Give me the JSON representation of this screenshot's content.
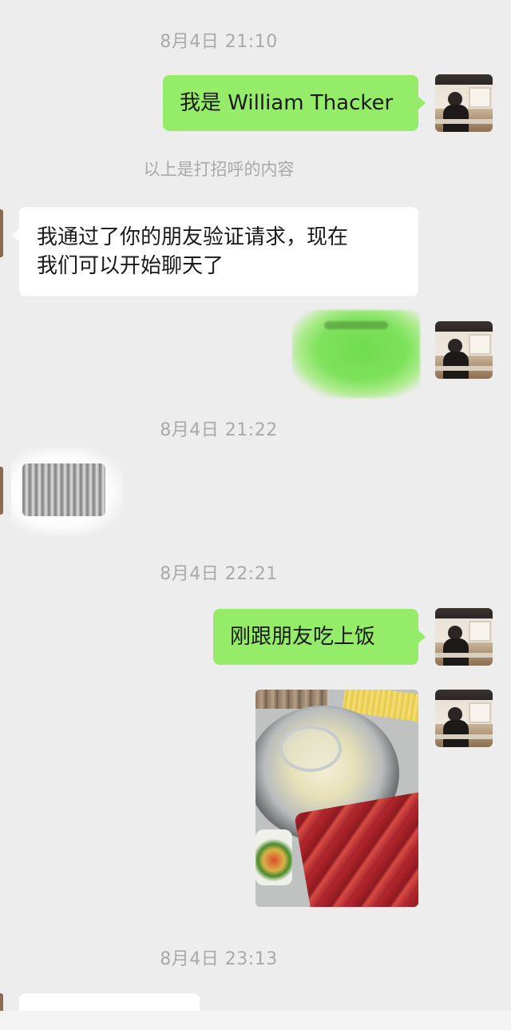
{
  "chat": {
    "timestamps": {
      "t1": "8月4日 21:10",
      "t2": "8月4日 21:22",
      "t3": "8月4日 22:21",
      "t4": "8月4日 23:13"
    },
    "system_note": "以上是打招呼的内容",
    "messages": {
      "out_greeting": "我是 William Thacker",
      "in_accept_line1": "我通过了你的朋友验证请求，现在",
      "in_accept_line2": "我们可以开始聊天了",
      "out_dinner": "刚跟朋友吃上饭"
    }
  },
  "colors": {
    "background": "#ededed",
    "outgoing_bubble": "#95ec69",
    "incoming_bubble": "#ffffff",
    "timestamp_text": "#a9a9a9"
  },
  "icons": {
    "self_avatar": "user-avatar-photo",
    "photo_message": "hotpot-photo"
  }
}
